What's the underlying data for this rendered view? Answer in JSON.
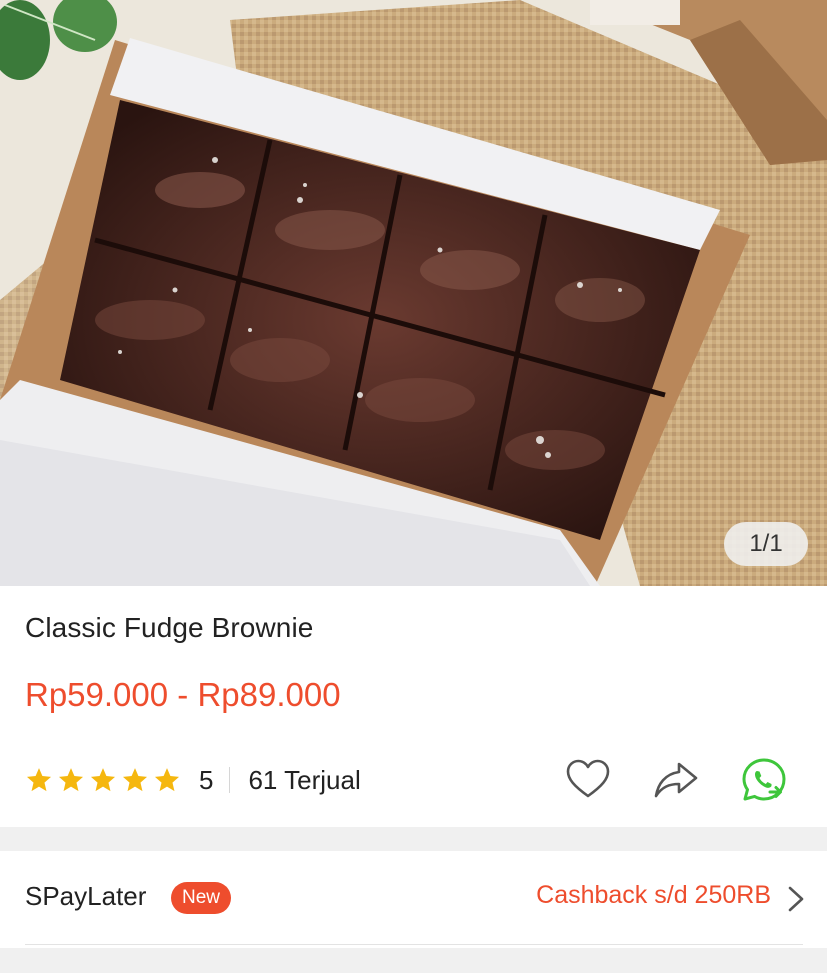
{
  "gallery": {
    "counter": "1/1"
  },
  "product": {
    "title": "Classic Fudge Brownie",
    "price_range": "Rp59.000 - Rp89.000",
    "rating": "5",
    "rating_stars": 5,
    "sold": "61 Terjual"
  },
  "actions": {
    "icons": [
      "heart-icon",
      "share-icon",
      "whatsapp-icon"
    ]
  },
  "paylater": {
    "label": "SPayLater",
    "badge": "New",
    "promo": "Cashback s/d 250RB"
  },
  "colors": {
    "accent": "#ee4d2d",
    "star": "#f5b70f",
    "whatsapp": "#3ec63b",
    "icon_gray": "#555555"
  }
}
